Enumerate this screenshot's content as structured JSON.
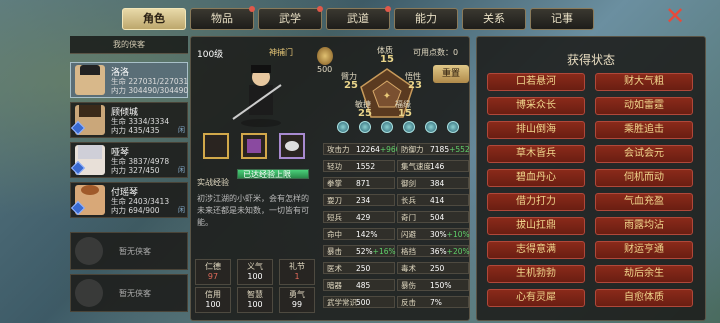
{
  "tabs": [
    {
      "label": "角色",
      "active": true
    },
    {
      "label": "物品",
      "dot": true
    },
    {
      "label": "武学",
      "dot": true
    },
    {
      "label": "武道",
      "dot": true
    },
    {
      "label": "能力",
      "dot": false
    },
    {
      "label": "关系",
      "dot": false
    },
    {
      "label": "记事",
      "dot": false
    }
  ],
  "close_icon": "close-x-icon",
  "roster": {
    "header": "我的侠客",
    "heroes": [
      {
        "name": "洛洛",
        "hp": "生命 227031/227031",
        "mp": "内力 304490/304490"
      },
      {
        "name": "顾倾城",
        "hp": "生命 3334/3334",
        "mp": "内力 435/435",
        "btn": "闲"
      },
      {
        "name": "哑琴",
        "hp": "生命 3837/4978",
        "mp": "内力 327/450",
        "btn": "闲"
      },
      {
        "name": "付瑶琴",
        "hp": "生命 2403/3413",
        "mp": "内力 694/900",
        "btn": "闲"
      }
    ],
    "empty": [
      "暂无侠客",
      "暂无侠客"
    ]
  },
  "char": {
    "level": "100级",
    "faction": "神捕门",
    "rank_value": "500",
    "points_label": "可用点数：0",
    "attr_labels": {
      "tizhi": "体质",
      "binli": "臂力",
      "wuxing": "悟性",
      "minjie": "敏捷",
      "fuyuan": "福缘"
    },
    "attr_values": {
      "tizhi": "15",
      "binli": "25",
      "wuxing": "23",
      "minjie": "25",
      "fuyuan": "15"
    },
    "reset": "重置",
    "exp_label": "实战经验",
    "exp_status": "已达经验上限",
    "exp_progress": 1,
    "desc": "初涉江湖的小虾米，会有怎样的未来还都是未知数，一切皆有可能。",
    "virtues": [
      {
        "k": "仁德",
        "v": "97"
      },
      {
        "k": "义气",
        "v": "100"
      },
      {
        "k": "礼节",
        "v": "1"
      },
      {
        "k": "信用",
        "v": "100"
      },
      {
        "k": "智慧",
        "v": "100"
      },
      {
        "k": "勇气",
        "v": "99"
      }
    ]
  },
  "stats_left": [
    {
      "k": "攻击力",
      "v": "12264",
      "p": "+960"
    },
    {
      "k": "轻功",
      "v": "1552"
    },
    {
      "k": "拳掌",
      "v": "871"
    },
    {
      "k": "耍刀",
      "v": "234"
    },
    {
      "k": "短兵",
      "v": "429"
    },
    {
      "k": "命中",
      "v": "142%"
    },
    {
      "k": "暴击",
      "v": "52%",
      "p": "+16%"
    },
    {
      "k": "医术",
      "v": "250"
    },
    {
      "k": "暗器",
      "v": "485"
    },
    {
      "k": "武学常识",
      "v": "500"
    }
  ],
  "stats_right": [
    {
      "k": "防御力",
      "v": "7185",
      "p": "+552"
    },
    {
      "k": "集气速度",
      "v": "146"
    },
    {
      "k": "御剑",
      "v": "384"
    },
    {
      "k": "长兵",
      "v": "414"
    },
    {
      "k": "奇门",
      "v": "504"
    },
    {
      "k": "闪避",
      "v": "30%",
      "p": "+10%"
    },
    {
      "k": "格挡",
      "v": "36%",
      "p": "+20%"
    },
    {
      "k": "毒术",
      "v": "250"
    },
    {
      "k": "暴伤",
      "v": "150%"
    },
    {
      "k": "反击",
      "v": "7%"
    }
  ],
  "status": {
    "title": "获得状态",
    "items": [
      "口若悬河",
      "财大气粗",
      "博采众长",
      "动如雷霆",
      "排山倒海",
      "乘胜追击",
      "草木皆兵",
      "会试会元",
      "碧血丹心",
      "伺机而动",
      "借力打力",
      "气血充盈",
      "拔山扛鼎",
      "雨露均沾",
      "志得意满",
      "财运亨通",
      "生机勃勃",
      "劫后余生",
      "心有灵犀",
      "自愈体质"
    ]
  },
  "colors": {
    "accent": "#e8d9a8",
    "gain": "#5fd06a",
    "pill": "#8a2a1a",
    "pill_text": "#f0d68c"
  }
}
